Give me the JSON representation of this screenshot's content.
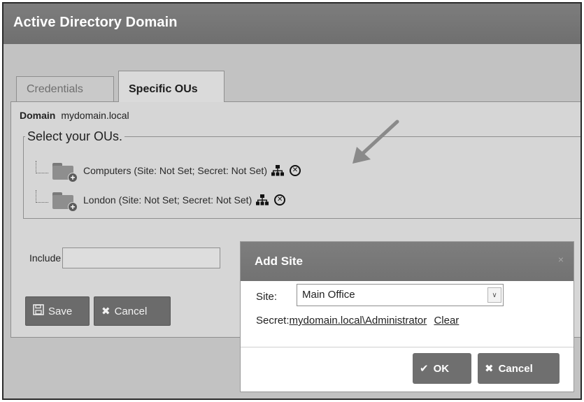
{
  "window": {
    "title": "Active Directory Domain"
  },
  "tabs": [
    {
      "label": "Credentials"
    },
    {
      "label": "Specific OUs"
    }
  ],
  "domain": {
    "label": "Domain",
    "value": "mydomain.local"
  },
  "ou_fieldset": {
    "legend": "Select your OUs."
  },
  "ous": [
    {
      "label": "Computers (Site: Not Set; Secret: Not Set)"
    },
    {
      "label": "London (Site: Not Set; Secret: Not Set)"
    }
  ],
  "include": {
    "label": "Include",
    "value": ""
  },
  "actions": {
    "save_label": "Save",
    "cancel_label": "Cancel"
  },
  "dialog": {
    "title": "Add Site",
    "close_glyph": "×",
    "site_label": "Site:",
    "site_value": "Main Office",
    "secret_label": "Secret:",
    "secret_value": "mydomain.local\\Administrator",
    "clear_label": "Clear",
    "ok_label": "OK",
    "cancel_label": "Cancel"
  }
}
